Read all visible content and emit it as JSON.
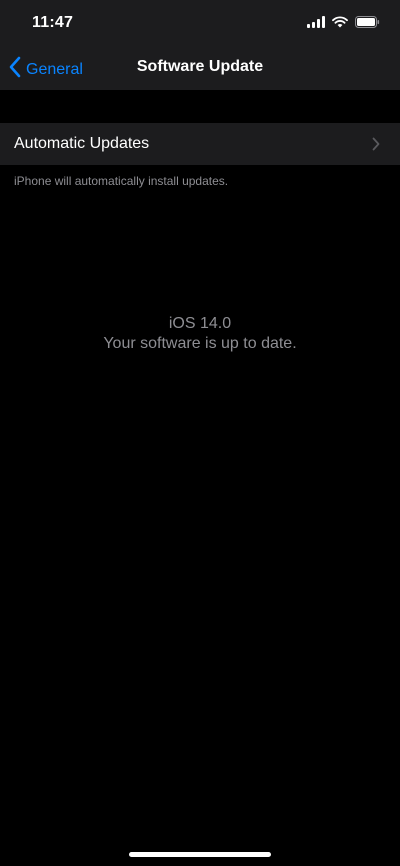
{
  "status_bar": {
    "time": "11:47",
    "icons": [
      "cellular-signal-icon",
      "wifi-icon",
      "battery-icon"
    ]
  },
  "nav": {
    "back_label": "General",
    "title": "Software Update",
    "accent_color": "#0a84ff"
  },
  "settings": {
    "automatic_updates_label": "Automatic Updates",
    "footer_note": "iPhone will automatically install updates."
  },
  "update_status": {
    "version": "iOS 14.0",
    "message": "Your software is up to date."
  },
  "colors": {
    "background": "#000000",
    "grouped_row": "#1c1c1e",
    "secondary_text": "#8e8e93"
  }
}
